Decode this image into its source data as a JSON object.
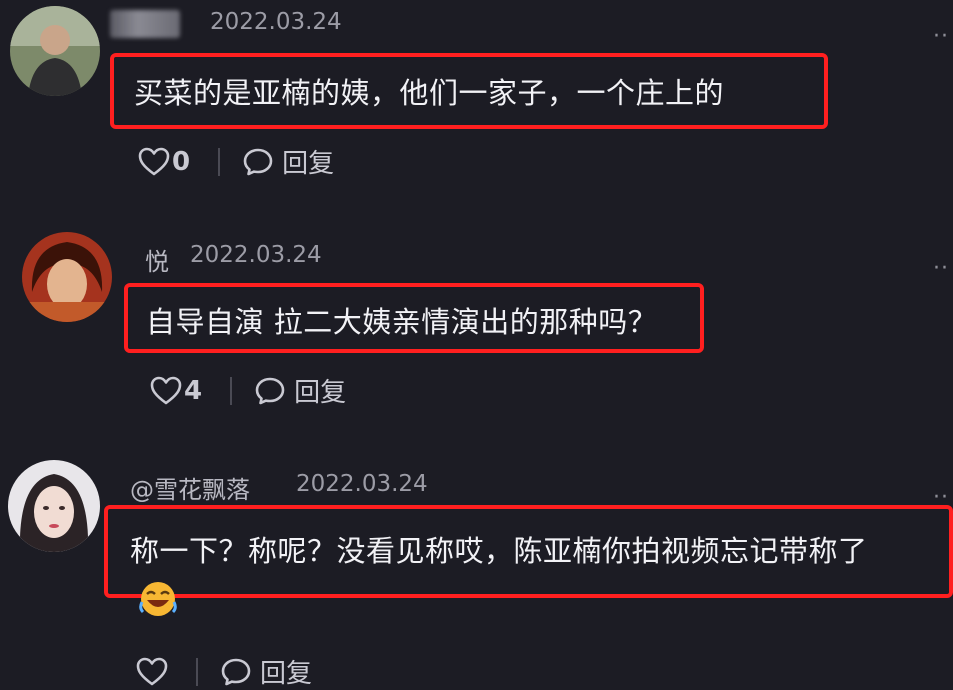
{
  "comments": [
    {
      "username": "",
      "date": "2022.03.24",
      "text": "买菜的是亚楠的姨，他们一家子，一个庄上的",
      "likes": "0",
      "reply_label": "回复",
      "more": "··"
    },
    {
      "username": "悦",
      "date": "2022.03.24",
      "text": "自导自演 拉二大姨亲情演出的那种吗？",
      "likes": "4",
      "reply_label": "回复",
      "more": "··"
    },
    {
      "username": "@雪花飘落",
      "date": "2022.03.24",
      "text": "称一下？称呢？没看见称哎，陈亚楠你拍视频忘记带称了",
      "reply_label": "回复",
      "more": "··"
    }
  ],
  "colors": {
    "background": "#1c1c24",
    "highlight_border": "#ff1f1f"
  },
  "icons": [
    "heart-icon",
    "comment-bubble-icon",
    "laughing-emoji-icon",
    "more-options-icon"
  ]
}
